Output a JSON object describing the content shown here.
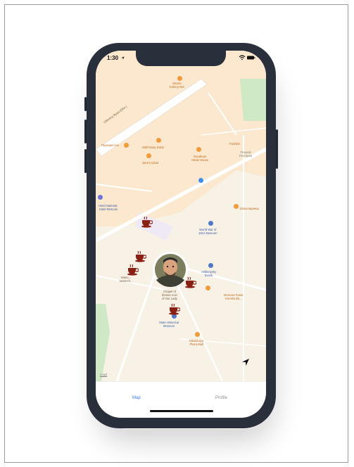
{
  "status_bar": {
    "time": "1:30"
  },
  "map": {
    "labels": {
      "okhotny": "Okhotny Ryad (Обл.)",
      "strana_kolony": "Strana\nKolony-Net",
      "perekrestok": "Перекресток",
      "wall_muay": "Wall Muay Salon",
      "janes": "Jane's Iyibar",
      "goodman": "Goodman\nSteak House",
      "pushkin": "Pushkin",
      "peshkov": "Пешков\nРесторан",
      "hotel_national": "Hotel National,\nHotel Moscow",
      "shokoladnitsa": "Шоколадница",
      "museum_1812": "World War of\n1812 Museum",
      "maneg": "Mane...\nManezh...",
      "chapel": "Chapel of\nIberian Icon\nof Our Lady",
      "artilleriysky": "Artilleriysky\nDvorik",
      "historical_museum": "State Historical\nMuseum",
      "nikolskaya": "Nikolskaya\nPlaza Mall",
      "tower": "Moscow Tower\nKremlin Bk...",
      "legal": "Legal"
    }
  },
  "tabbar": {
    "map_label": "Map",
    "profile_label": "Profile"
  },
  "colors": {
    "accent": "#3478f6",
    "frame": "#29303b"
  }
}
